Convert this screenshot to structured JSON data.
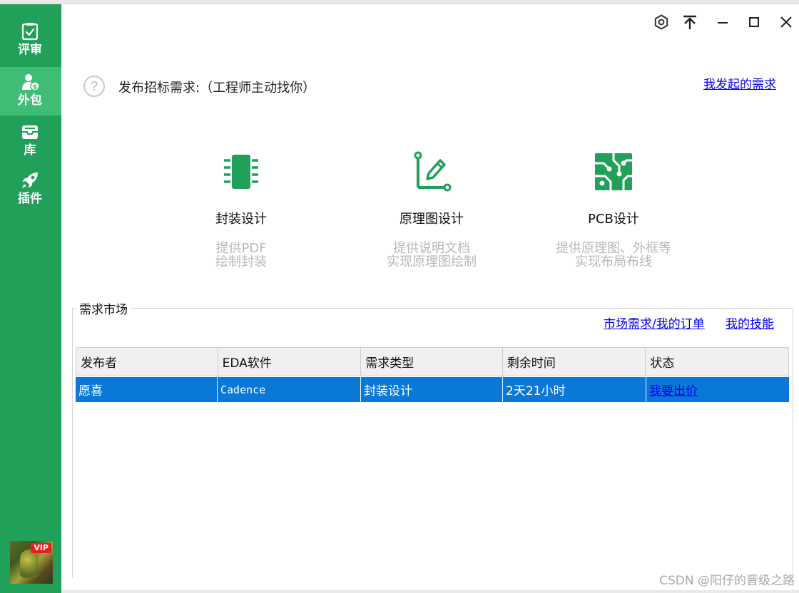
{
  "sidebar": {
    "items": [
      {
        "label": "评审",
        "icon": "checklist-icon"
      },
      {
        "label": "外包",
        "icon": "user-dollar-icon",
        "active": true
      },
      {
        "label": "库",
        "icon": "inbox-tray-icon"
      },
      {
        "label": "插件",
        "icon": "rocket-icon"
      }
    ],
    "avatar_badge": "VIP"
  },
  "window_controls": [
    "settings-icon",
    "pin-top-icon",
    "minimize-icon",
    "maximize-icon",
    "close-icon"
  ],
  "header": {
    "help_icon": "?",
    "title": "发布招标需求:（工程师主动找你）",
    "my_requests_link": "我发起的需求"
  },
  "services": [
    {
      "title": "封装设计",
      "desc_line1": "提供PDF",
      "desc_line2": "绘制封装",
      "icon": "chip-icon"
    },
    {
      "title": "原理图设计",
      "desc_line1": "提供说明文档",
      "desc_line2": "实现原理图绘制",
      "icon": "pen-schematic-icon"
    },
    {
      "title": "PCB设计",
      "desc_line1": "提供原理图、外框等",
      "desc_line2": "实现布局布线",
      "icon": "pcb-traces-icon"
    }
  ],
  "market": {
    "title": "需求市场",
    "orders_link": "市场需求/我的订单",
    "skills_link": "我的技能",
    "columns": [
      "发布者",
      "EDA软件",
      "需求类型",
      "剩余时间",
      "状态"
    ],
    "rows": [
      {
        "publisher": "愿喜",
        "eda": "Cadence",
        "type": "封装设计",
        "remaining": "2天21小时",
        "action": "我要出价"
      }
    ]
  },
  "watermark": "CSDN @阳仔的晋级之路",
  "colors": {
    "sidebar": "#21a05a",
    "sidebar_active": "#3fbd76",
    "selection": "#0a78d7",
    "link": "#0000ee",
    "icon_green": "#21a05a"
  }
}
